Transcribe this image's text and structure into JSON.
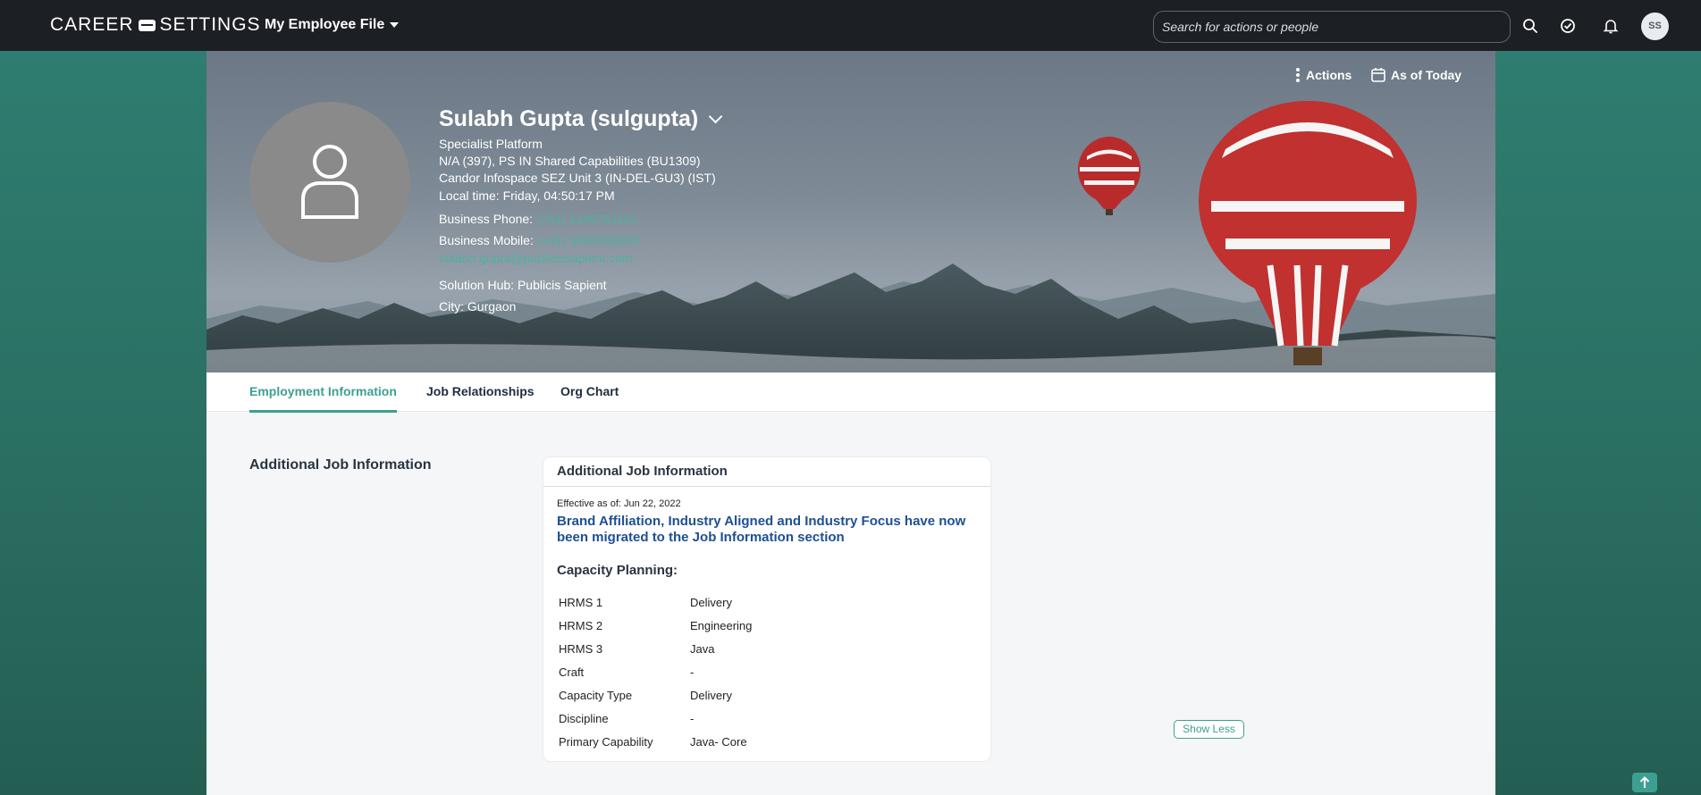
{
  "brand": {
    "logo_left": "CAREER",
    "logo_right": "SETTINGS"
  },
  "header": {
    "menu_title": "My Employee File",
    "search_placeholder": "Search for actions or people",
    "avatar_initials": "SS"
  },
  "profile": {
    "name": "Sulabh Gupta (sulgupta)",
    "line1": "Specialist Platform",
    "line2": "N/A (397), PS IN Shared Capabilities (BU1309)",
    "line3": "Candor Infospace SEZ Unit 3 (IN-DEL-GU3) (IST)",
    "local_time_label": "Local time:",
    "local_time_value": "Friday, 04:50:17 PM",
    "business_phone_label": "Business Phone:",
    "business_phone_value": "(+91) 1246761101",
    "business_mobile_label": "Business Mobile:",
    "business_mobile_value": "(+91) 9990358330",
    "email": "sulabh.gupta@publicissapient.com",
    "solution_hub_label": "Solution Hub:",
    "solution_hub_value": "Publicis Sapient",
    "city_label": "City:",
    "city_value": "Gurgaon"
  },
  "hero_actions": {
    "actions": "Actions",
    "as_of": "As of Today"
  },
  "tabs": [
    "Employment Information",
    "Job Relationships",
    "Org Chart"
  ],
  "section": {
    "title": "Additional Job Information"
  },
  "card": {
    "header": "Additional Job Information",
    "effective": "Effective as of: Jun 22, 2022",
    "notice": "Brand Affiliation, Industry Aligned and Industry Focus have now been migrated to the Job Information section",
    "capacity_title": "Capacity Planning:",
    "rows": [
      {
        "label": "HRMS 1",
        "value": "Delivery"
      },
      {
        "label": "HRMS 2",
        "value": "Engineering"
      },
      {
        "label": "HRMS 3",
        "value": "Java"
      },
      {
        "label": "Craft",
        "value": "-"
      },
      {
        "label": "Capacity Type",
        "value": "Delivery"
      },
      {
        "label": "Discipline",
        "value": "-"
      },
      {
        "label": "Primary Capability",
        "value": "Java- Core"
      }
    ]
  },
  "buttons": {
    "show_less": "Show Less"
  },
  "colors": {
    "accent": "#3d9f92",
    "topbar": "#1c1f24",
    "link": "#4fb0a2",
    "notice": "#1e4f94"
  }
}
